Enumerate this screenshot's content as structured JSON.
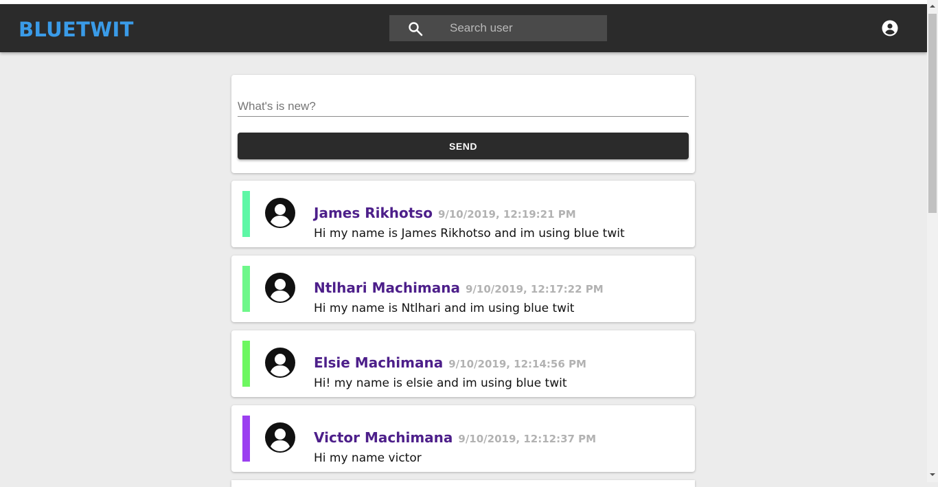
{
  "app": {
    "brand": "BLUETWIT",
    "brand_color": "#3a9be8"
  },
  "search": {
    "placeholder": "Search user",
    "icon": "search-icon"
  },
  "header": {
    "account_icon": "account-circle-icon"
  },
  "compose": {
    "placeholder": "What's is new?",
    "send_label": "SEND"
  },
  "posts": [
    {
      "name": "James Rikhotso",
      "time": "9/10/2019, 12:19:21 PM",
      "message": "Hi my name is James Rikhotso and im using blue twit",
      "accent": "#5ef7a6"
    },
    {
      "name": "Ntlhari Machimana",
      "time": "9/10/2019, 12:17:22 PM",
      "message": "Hi my name is Ntlhari and im using blue twit",
      "accent": "#6ef78a"
    },
    {
      "name": "Elsie Machimana",
      "time": "9/10/2019, 12:14:56 PM",
      "message": "Hi! my name is elsie and im using blue twit",
      "accent": "#6df760"
    },
    {
      "name": "Victor Machimana",
      "time": "9/10/2019, 12:12:37 PM",
      "message": "Hi my name victor",
      "accent": "#9b3ff0"
    }
  ]
}
